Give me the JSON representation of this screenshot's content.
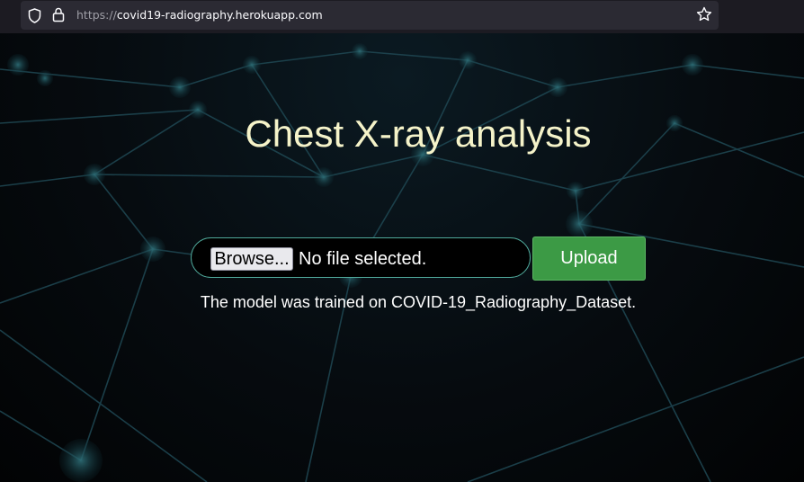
{
  "browser": {
    "url_scheme": "https://",
    "url_host": "covid19-radiography.herokuapp.com"
  },
  "page": {
    "title": "Chest X-ray analysis",
    "browse_label": "Browse...",
    "file_status": "No file selected.",
    "upload_label": "Upload",
    "note": "The model was trained on COVID-19_Radiography_Dataset."
  },
  "colors": {
    "title": "#f5f3c9",
    "upload_button": "#3c9a45",
    "field_border": "#4fa89a",
    "background": "#05080b"
  },
  "icons": {
    "shield": "shield-icon",
    "lock": "lock-icon",
    "star": "bookmark-star-icon"
  }
}
